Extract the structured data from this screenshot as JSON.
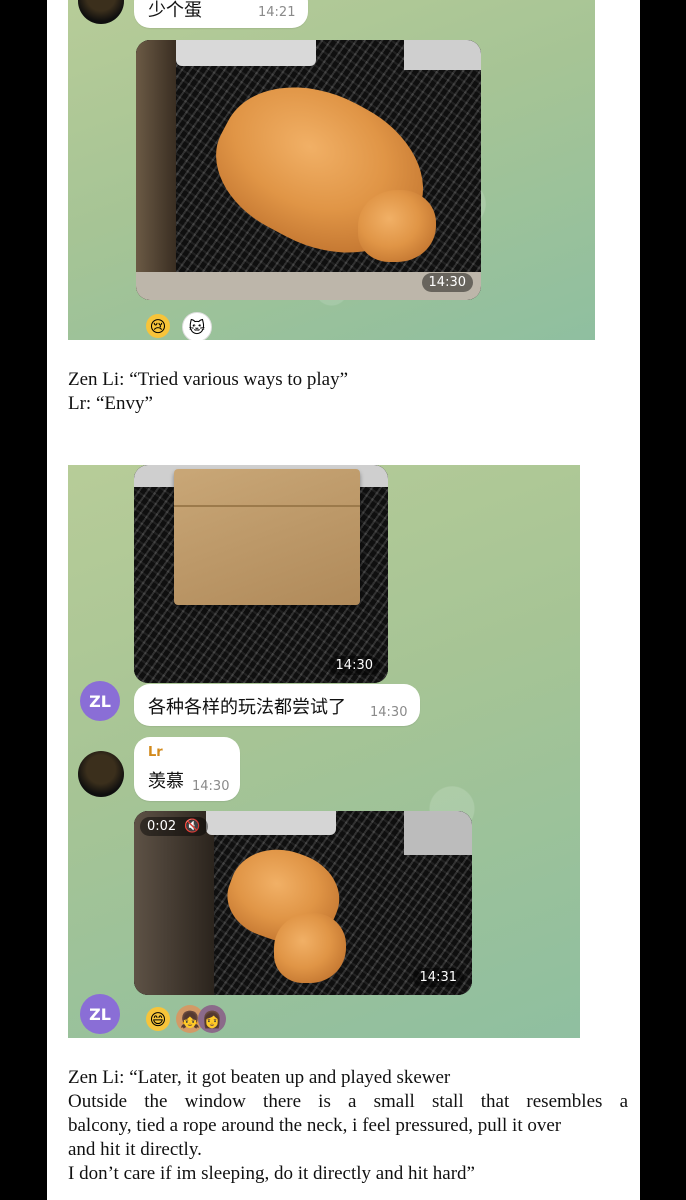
{
  "top_block": {
    "top_sender_partial": "少个蛋",
    "top_time": "14:21",
    "photo_time": "14:30",
    "reactions": [
      "crying-face",
      "avatar-sticker"
    ]
  },
  "caption1": {
    "line1": "Zen Li: “Tried various ways to play”",
    "line2": "Lr: “Envy”"
  },
  "bottom_block": {
    "box_photo_time": "14:30",
    "zl_avatar": "ZL",
    "zl_message": "各种各样的玩法都尝试了",
    "zl_message_time": "14:30",
    "lr_name": "Lr",
    "lr_message": "羡慕",
    "lr_message_time": "14:30",
    "video_duration": "0:02",
    "video_time": "14:31",
    "zl_avatar_2": "ZL",
    "reactions": [
      "grinning-face",
      "avatar-sticker",
      "avatar-sticker"
    ]
  },
  "caption2": {
    "line1": "Zen Li: “Later, it got beaten up and played skewer",
    "line2": "Outside the window there is a small stall that resembles a",
    "line3": "balcony, tied a rope around the neck, i feel pressured, pull it over",
    "line4": "and hit it directly.",
    "line5": "I don’t care if im sleeping, do it directly and hit hard”"
  },
  "colors": {
    "chat_bg": "#a9c496",
    "avatar_zl": "#8a6ed6",
    "lr_name": "#d28a1c"
  }
}
